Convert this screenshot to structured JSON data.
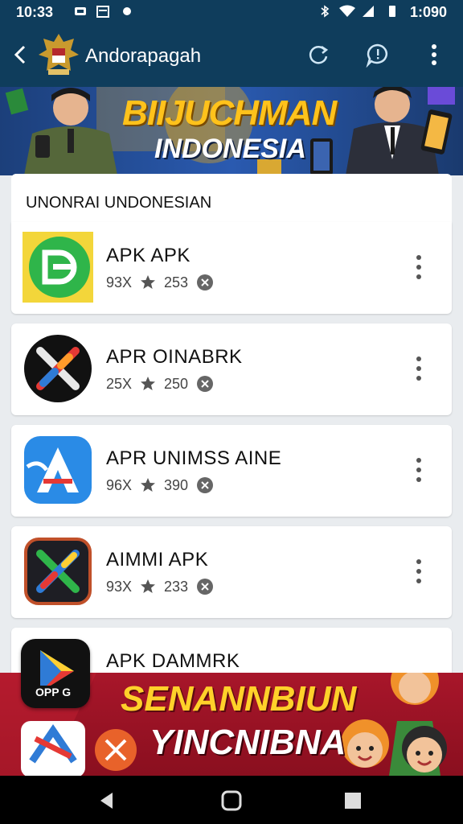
{
  "status": {
    "time_left": "10:33",
    "time_right": "1:090"
  },
  "appbar": {
    "title": "Andorapagah"
  },
  "banner": {
    "line1": "BIIJUCHMAN",
    "line2": "INDONESIA"
  },
  "list": {
    "header": "UNONRAI UNDONESIAN",
    "items": [
      {
        "name": "APK APK",
        "downloads": "93X",
        "rating": "253"
      },
      {
        "name": "APR OINABRK",
        "downloads": "25X",
        "rating": "250"
      },
      {
        "name": "APR UNIMSS AINE",
        "downloads": "96X",
        "rating": "390"
      },
      {
        "name": "AIMMI APK",
        "downloads": "93X",
        "rating": "233"
      },
      {
        "name": "APK DAMMRK",
        "icon_label": "OPP G"
      }
    ]
  },
  "promo": {
    "line1": "SENANNBIUN",
    "line2": "YINCNIBNA"
  },
  "colors": {
    "appbar": "#0f3d5c",
    "banner_gold": "#ffc21b",
    "promo_red": "#a8162a"
  }
}
